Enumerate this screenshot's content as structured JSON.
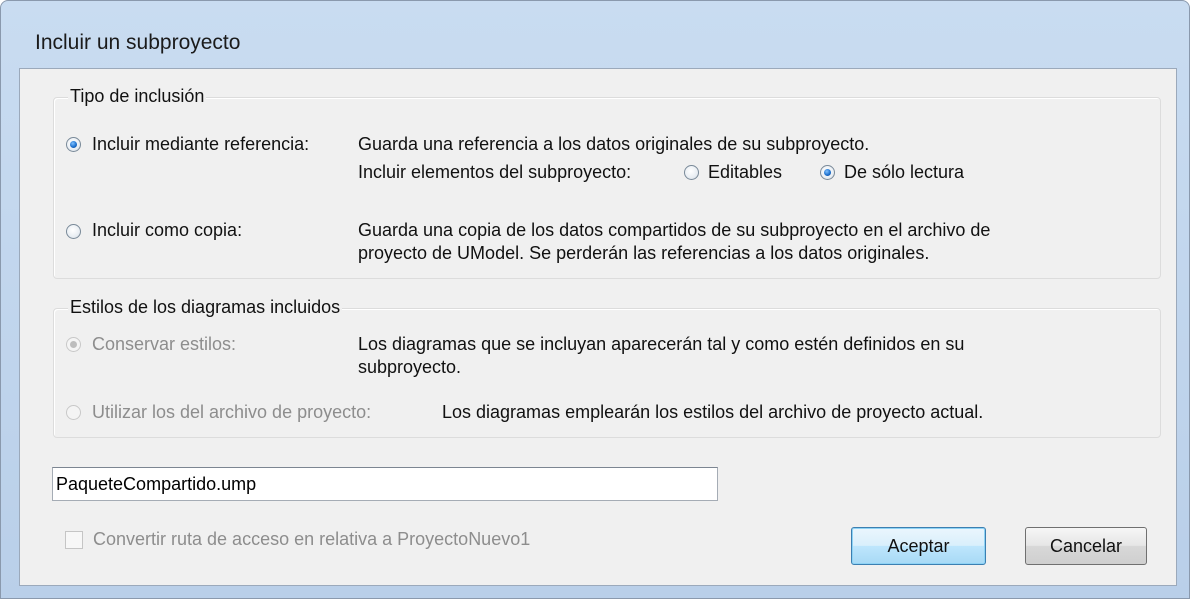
{
  "dialog": {
    "title": "Incluir un subproyecto"
  },
  "inclusion_group": {
    "label": "Tipo de inclusión",
    "by_reference": {
      "label": "Incluir mediante referencia:",
      "selected": true,
      "description": "Guarda una referencia a los datos originales de su subproyecto.",
      "elements_label": "Incluir elementos del subproyecto:",
      "option_editable": "Editables",
      "option_readonly": "De sólo lectura",
      "readonly_selected": true
    },
    "as_copy": {
      "label": "Incluir como copia:",
      "selected": false,
      "description_line1": "Guarda una copia de los datos compartidos de su subproyecto en el archivo de",
      "description_line2": "proyecto de UModel. Se perderán las referencias a los datos originales."
    }
  },
  "styles_group": {
    "label": "Estilos de los diagramas incluidos",
    "keep_styles": {
      "label": "Conservar estilos:",
      "selected": true,
      "enabled": false,
      "description_line1": "Los diagramas que se incluyan aparecerán tal y como estén definidos en su",
      "description_line2": "subproyecto."
    },
    "use_project": {
      "label": "Utilizar los del archivo de proyecto:",
      "selected": false,
      "enabled": false,
      "description": "Los diagramas emplearán los estilos del archivo de proyecto actual."
    }
  },
  "file_input": {
    "value": "PaqueteCompartido.ump"
  },
  "relative_path": {
    "label": "Convertir ruta de acceso en relativa a ProyectoNuevo1",
    "checked": false,
    "enabled": false
  },
  "buttons": {
    "ok": "Aceptar",
    "cancel": "Cancelar"
  }
}
